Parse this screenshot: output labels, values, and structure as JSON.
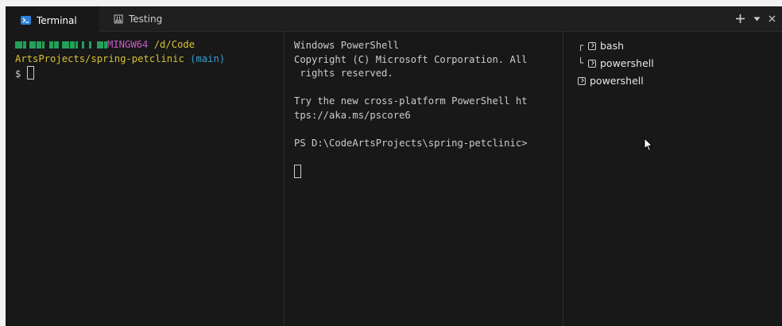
{
  "tabs": [
    {
      "label": "Terminal",
      "icon": "terminal-icon",
      "active": true
    },
    {
      "label": "Testing",
      "icon": "flask-icon",
      "active": false
    }
  ],
  "actions": [
    {
      "label": "+",
      "icon": "plus-icon"
    },
    {
      "label": "▾",
      "icon": "chevron-down-icon"
    },
    {
      "label": "×",
      "icon": "close-icon"
    }
  ],
  "bash": {
    "prompt_env": "MINGW64",
    "path_line1": "/d/Code",
    "path_line2": "ArtsProjects/spring-petclinic",
    "branch": "(main)",
    "prompt_symbol": "$"
  },
  "powershell": {
    "lines": [
      "Windows PowerShell",
      "Copyright (C) Microsoft Corporation. All",
      " rights reserved.",
      "",
      "Try the new cross-platform PowerShell ht",
      "tps://aka.ms/pscore6",
      "",
      "PS D:\\CodeArtsProjects\\spring-petclinic>"
    ]
  },
  "terminal_list": [
    {
      "label": "bash",
      "tree": "┌",
      "icon": "bash-terminal-icon"
    },
    {
      "label": "powershell",
      "tree": "└",
      "icon": "powershell-icon"
    },
    {
      "label": "powershell",
      "tree": "",
      "icon": "powershell-icon"
    }
  ],
  "colors": {
    "background": "#181818",
    "tab_active_icon": "#2f7fd6",
    "prompt_user_host": "#23a05a",
    "prompt_env": "#c85ac8",
    "prompt_path": "#d7c230",
    "prompt_branch": "#3aa0d6"
  }
}
